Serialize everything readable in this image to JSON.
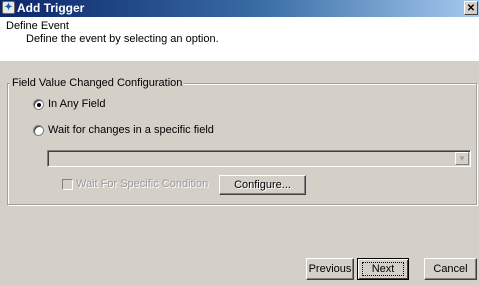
{
  "window": {
    "title": "Add Trigger",
    "close_glyph": "✕"
  },
  "header": {
    "title": "Define Event",
    "description": "Define the event by selecting an option."
  },
  "group": {
    "legend": "Field Value Changed Configuration",
    "options": [
      {
        "label": "In Any Field",
        "selected": true
      },
      {
        "label": "Wait for changes in a specific field",
        "selected": false
      }
    ],
    "field_select": {
      "value": "",
      "enabled": false
    },
    "condition_checkbox": {
      "label": "Wait For Specific Condition",
      "checked": false,
      "enabled": false
    },
    "configure_label": "Configure..."
  },
  "footer": {
    "previous_label": "Previous",
    "next_label": "Next",
    "cancel_label": "Cancel"
  },
  "colors": {
    "titlebar_start": "#0a246a",
    "titlebar_end": "#a6caf0",
    "dialog_face": "#d4d0c8"
  }
}
